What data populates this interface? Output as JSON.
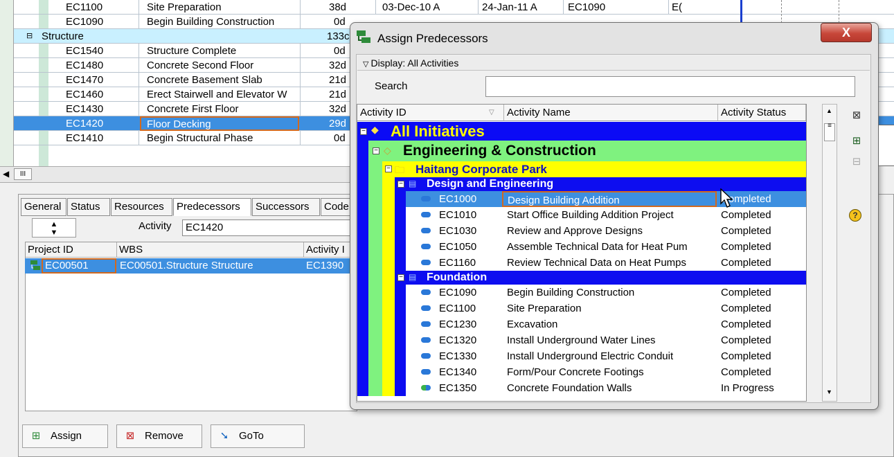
{
  "background_grid": {
    "rows": [
      {
        "id": "EC1100",
        "name": "Site Preparation",
        "dur": "38d",
        "start": "03-Dec-10 A",
        "finish": "24-Jan-11 A",
        "pred": "EC1090",
        "succ": "E("
      },
      {
        "id": "EC1090",
        "name": "Begin Building Construction",
        "dur": "0d",
        "start": "",
        "finish": "",
        "pred": "",
        "succ": ""
      },
      {
        "group": "Structure",
        "dur": "133c"
      },
      {
        "id": "EC1540",
        "name": "Structure Complete",
        "dur": "0d"
      },
      {
        "id": "EC1480",
        "name": "Concrete Second Floor",
        "dur": "32d"
      },
      {
        "id": "EC1470",
        "name": "Concrete Basement Slab",
        "dur": "21d"
      },
      {
        "id": "EC1460",
        "name": "Erect Stairwell and Elevator W",
        "dur": "21d"
      },
      {
        "id": "EC1430",
        "name": "Concrete First Floor",
        "dur": "32d"
      },
      {
        "id": "EC1420",
        "name": "Floor Decking",
        "dur": "29d",
        "selected": true
      },
      {
        "id": "EC1410",
        "name": "Begin Structural Phase",
        "dur": "0d"
      }
    ],
    "scroll_label": "III"
  },
  "detail_panel": {
    "tabs": [
      "General",
      "Status",
      "Resources",
      "Predecessors",
      "Successors",
      "Code"
    ],
    "active_tab": "Predecessors",
    "activity_label": "Activity",
    "activity_value": "EC1420",
    "columns": [
      "Project ID",
      "WBS",
      "Activity I"
    ],
    "row": {
      "project_id": "EC00501",
      "wbs": "EC00501.Structure Structure",
      "activity": "EC1390"
    },
    "buttons": {
      "assign": "Assign",
      "remove": "Remove",
      "goto": "GoTo"
    }
  },
  "dialog": {
    "title": "Assign Predecessors",
    "close": "X",
    "display_label": "Display: All Activities",
    "search_label": "Search",
    "search_value": "",
    "columns": {
      "id": "Activity ID",
      "name": "Activity Name",
      "status": "Activity Status"
    },
    "level0": "All  Initiatives",
    "level1": "Engineering & Construction",
    "level2": "Haitang Corporate Park",
    "wbs_design": "Design and Engineering",
    "wbs_foundation": "Foundation",
    "design_rows": [
      {
        "id": "EC1000",
        "name": "Design Building Addition",
        "status": "Completed"
      },
      {
        "id": "EC1010",
        "name": "Start Office Building Addition Project",
        "status": "Completed"
      },
      {
        "id": "EC1030",
        "name": "Review and Approve Designs",
        "status": "Completed"
      },
      {
        "id": "EC1050",
        "name": "Assemble Technical Data for Heat Pum",
        "status": "Completed"
      },
      {
        "id": "EC1160",
        "name": "Review Technical Data on Heat Pumps",
        "status": "Completed"
      }
    ],
    "foundation_rows": [
      {
        "id": "EC1090",
        "name": "Begin Building Construction",
        "status": "Completed"
      },
      {
        "id": "EC1100",
        "name": "Site Preparation",
        "status": "Completed"
      },
      {
        "id": "EC1230",
        "name": "Excavation",
        "status": "Completed"
      },
      {
        "id": "EC1320",
        "name": "Install Underground Water Lines",
        "status": "Completed"
      },
      {
        "id": "EC1330",
        "name": "Install Underground Electric Conduit",
        "status": "Completed"
      },
      {
        "id": "EC1340",
        "name": "Form/Pour Concrete Footings",
        "status": "Completed"
      },
      {
        "id": "EC1350",
        "name": "Concrete Foundation Walls",
        "status": "In Progress"
      }
    ]
  },
  "colors": {
    "selection": "#3d8fe0",
    "level0": "#0b0bf5",
    "level1": "#7ff27f",
    "level2": "#ffff00",
    "wbs": "#0d0df0"
  }
}
